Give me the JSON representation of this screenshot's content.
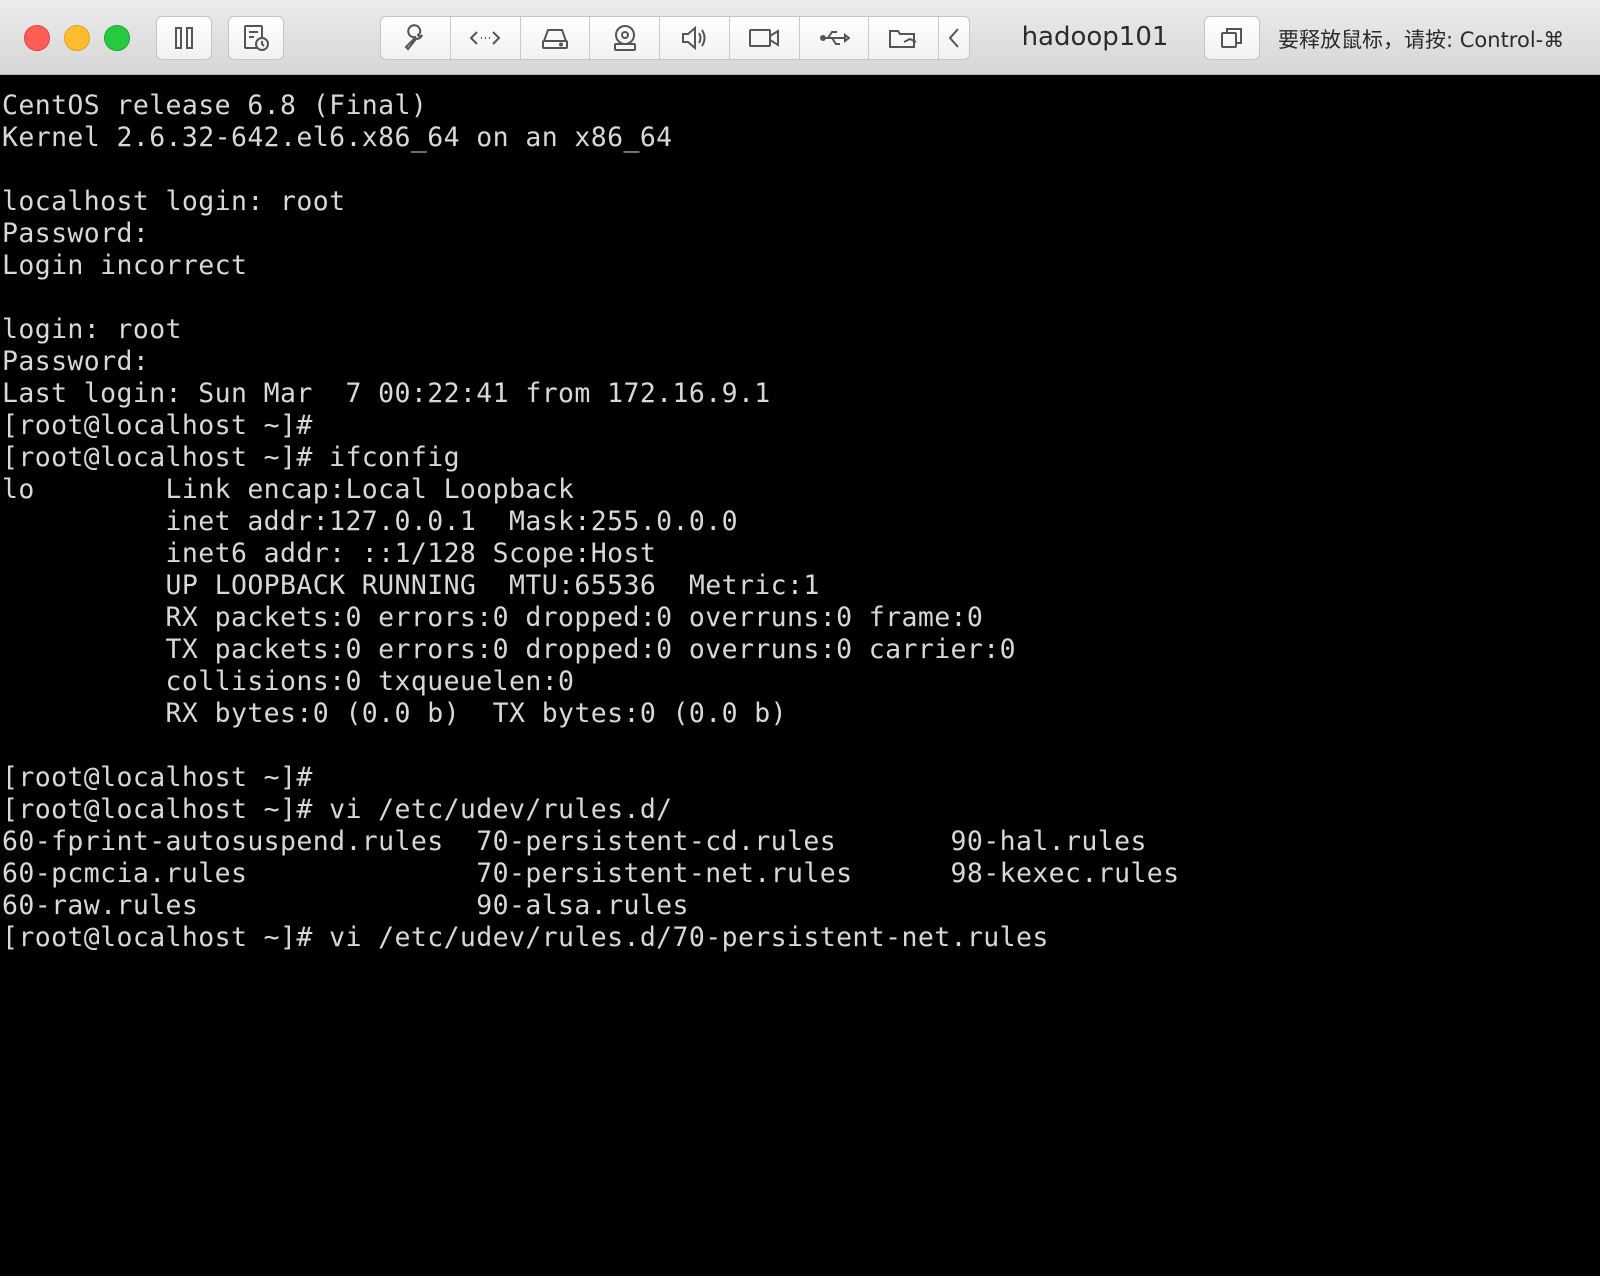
{
  "window": {
    "title": "hadoop101",
    "release_hint": "要释放鼠标，请按: Control-⌘"
  },
  "toolbar": {
    "pause_icon": "pause-icon",
    "snapshot_icon": "snapshot-icon",
    "items": [
      {
        "icon": "wrench-icon"
      },
      {
        "icon": "code-arrows-icon"
      },
      {
        "icon": "hard-drive-icon"
      },
      {
        "icon": "camera-device-icon"
      },
      {
        "icon": "speaker-icon"
      },
      {
        "icon": "video-camera-icon"
      },
      {
        "icon": "usb-icon"
      },
      {
        "icon": "shared-folder-icon"
      },
      {
        "icon": "chevron-left-icon"
      }
    ],
    "fullscreen_icon": "fullscreen-icon"
  },
  "terminal": {
    "lines": [
      "CentOS release 6.8 (Final)",
      "Kernel 2.6.32-642.el6.x86_64 on an x86_64",
      "",
      "localhost login: root",
      "Password:",
      "Login incorrect",
      "",
      "login: root",
      "Password:",
      "Last login: Sun Mar  7 00:22:41 from 172.16.9.1",
      "[root@localhost ~]#",
      "[root@localhost ~]# ifconfig",
      "lo        Link encap:Local Loopback",
      "          inet addr:127.0.0.1  Mask:255.0.0.0",
      "          inet6 addr: ::1/128 Scope:Host",
      "          UP LOOPBACK RUNNING  MTU:65536  Metric:1",
      "          RX packets:0 errors:0 dropped:0 overruns:0 frame:0",
      "          TX packets:0 errors:0 dropped:0 overruns:0 carrier:0",
      "          collisions:0 txqueuelen:0",
      "          RX bytes:0 (0.0 b)  TX bytes:0 (0.0 b)",
      "",
      "[root@localhost ~]#",
      "[root@localhost ~]# vi /etc/udev/rules.d/",
      "60-fprint-autosuspend.rules  70-persistent-cd.rules       90-hal.rules",
      "60-pcmcia.rules              70-persistent-net.rules      98-kexec.rules",
      "60-raw.rules                 90-alsa.rules",
      "[root@localhost ~]# vi /etc/udev/rules.d/70-persistent-net.rules"
    ]
  }
}
